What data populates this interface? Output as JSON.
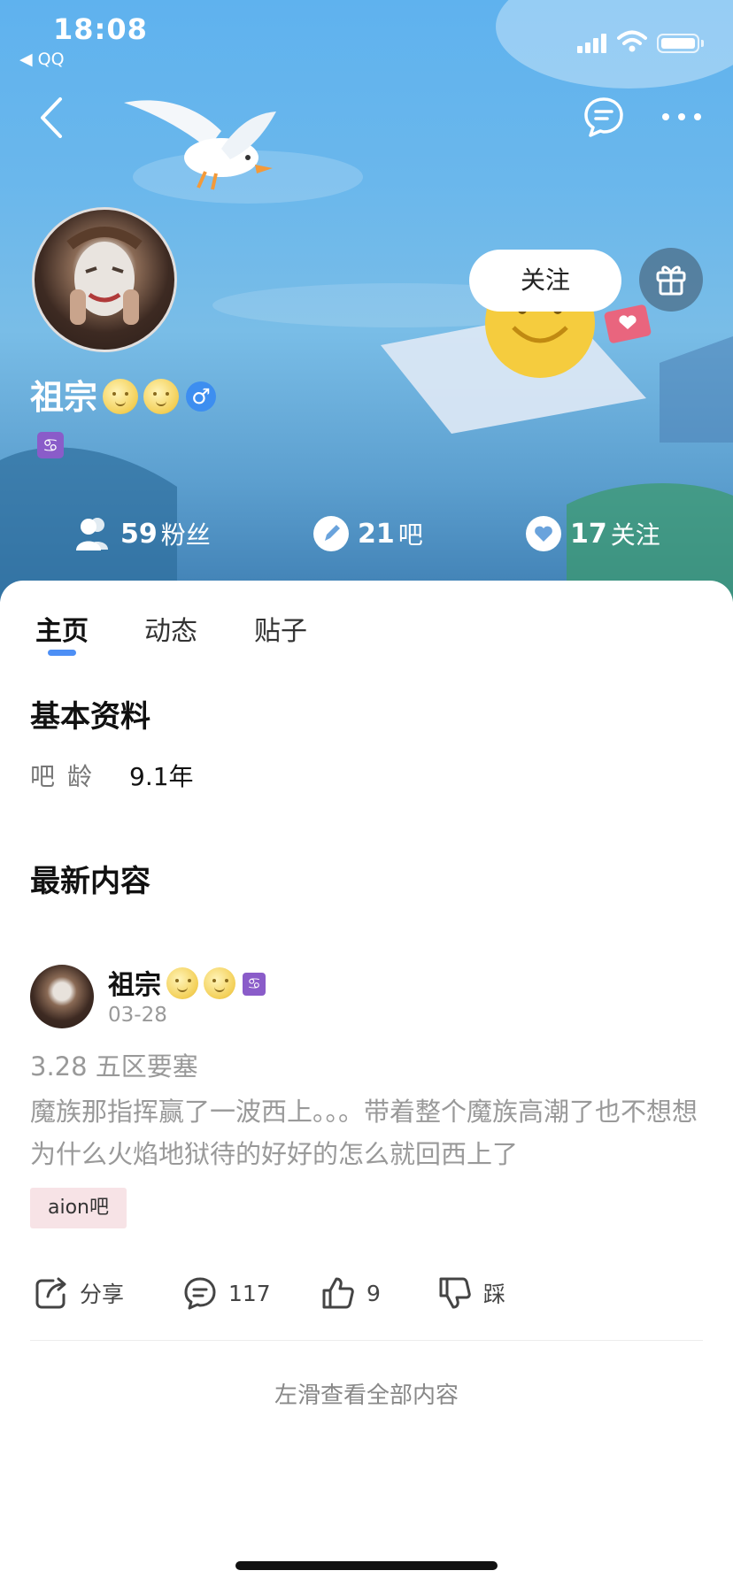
{
  "status": {
    "time": "18:08",
    "back_app": "◀ QQ"
  },
  "profile": {
    "name": "祖宗",
    "gender_symbol": "♂",
    "zodiac_symbol": "♋"
  },
  "actions": {
    "follow_label": "关注"
  },
  "stats": [
    {
      "num": "59",
      "label": "粉丝"
    },
    {
      "num": "21",
      "label": "吧"
    },
    {
      "num": "17",
      "label": "关注"
    }
  ],
  "tabs": [
    "主页",
    "动态",
    "贴子"
  ],
  "basic": {
    "heading": "基本资料",
    "age_label": "吧龄",
    "age_value": "9.1年"
  },
  "latest": {
    "heading": "最新内容"
  },
  "post": {
    "author": "祖宗",
    "date": "03-28",
    "title": "3.28 五区要塞",
    "body": "魔族那指挥赢了一波西上。。。带着整个魔族高潮了也不想想为什么火焰地狱待的好好的怎么就回西上了",
    "tag": "aion吧",
    "share_label": "分享",
    "comment_count": "117",
    "like_count": "9",
    "dislike_label": "踩"
  },
  "footer": {
    "more_label": "左滑查看全部内容"
  },
  "colors": {
    "accent": "#4d8ff5",
    "tag_bg": "#f7e3e6",
    "zodiac_bg": "#8a5cc9"
  }
}
